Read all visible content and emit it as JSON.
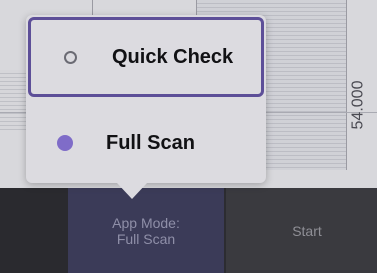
{
  "graph": {
    "axis_label": "54.000"
  },
  "popup": {
    "options": [
      {
        "label": "Quick Check",
        "selected": false
      },
      {
        "label": "Full Scan",
        "selected": true
      }
    ]
  },
  "toolbar": {
    "mode_button": {
      "line1": "App Mode:",
      "line2": "Full Scan"
    },
    "start_button": {
      "label": "Start"
    }
  },
  "colors": {
    "accent": "#7f6cc8",
    "focus_border": "#5d4f98",
    "popup_bg": "#dcdbe0",
    "mode_button_bg": "#3b3b58"
  }
}
